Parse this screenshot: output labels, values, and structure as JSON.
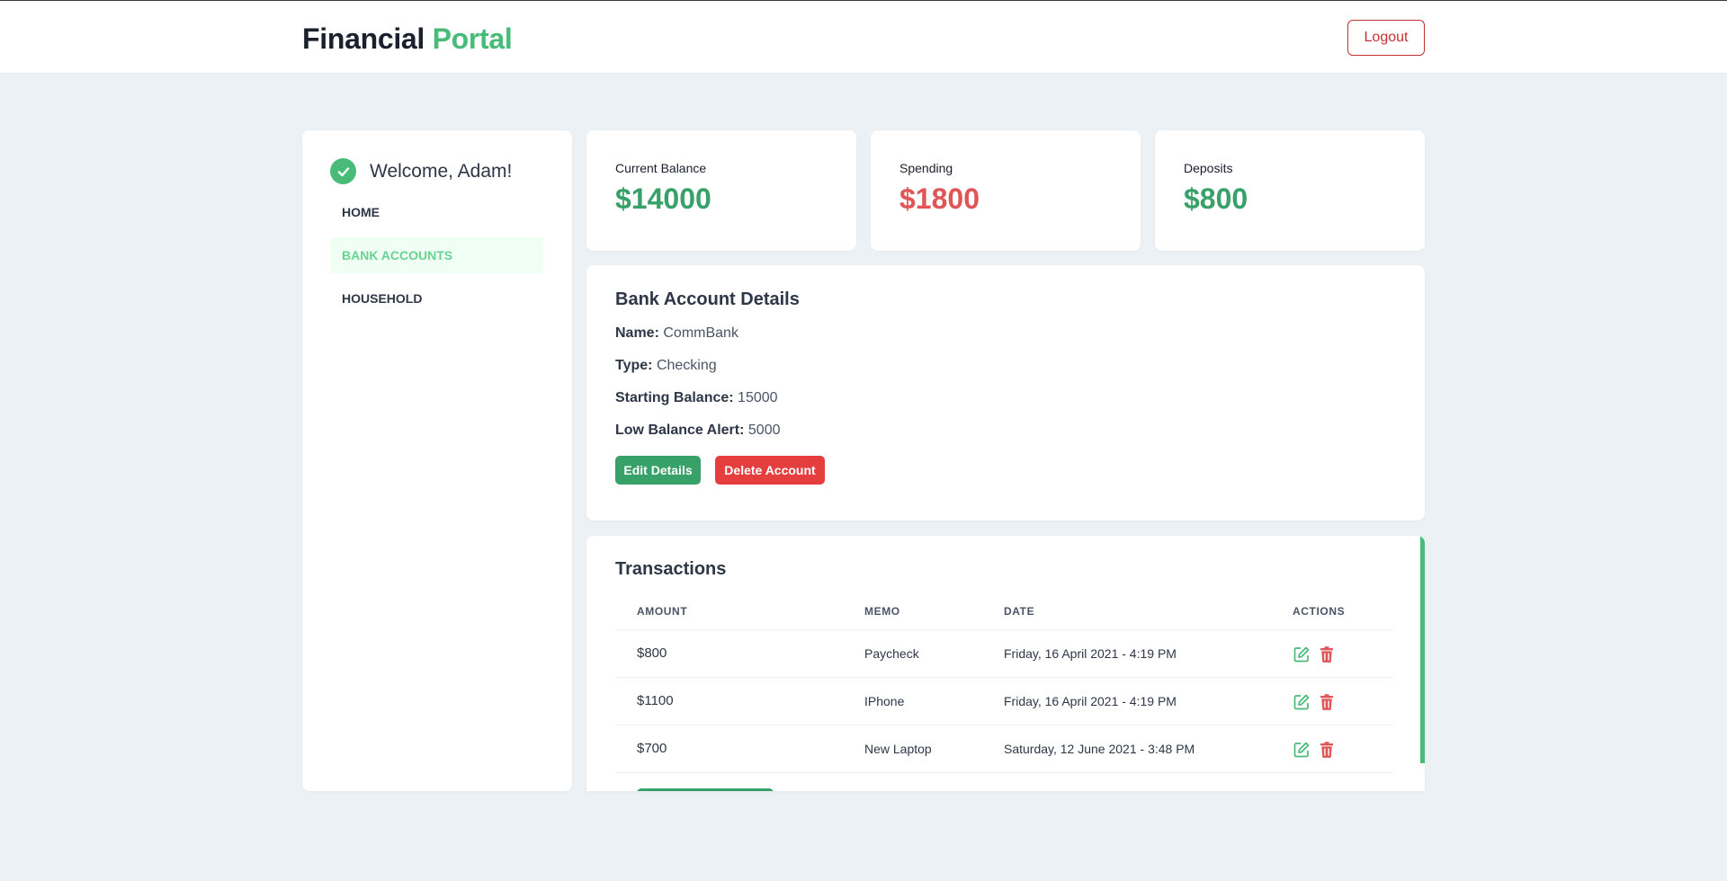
{
  "header": {
    "brand_part1": "Financial",
    "brand_part2": "Portal",
    "logout_label": "Logout"
  },
  "sidebar": {
    "welcome": "Welcome, Adam!",
    "items": [
      {
        "label": "HOME",
        "active": false
      },
      {
        "label": "BANK ACCOUNTS",
        "active": true
      },
      {
        "label": "HOUSEHOLD",
        "active": false
      }
    ]
  },
  "stats": [
    {
      "label": "Current Balance",
      "value": "$14000",
      "tone": "positive"
    },
    {
      "label": "Spending",
      "value": "$1800",
      "tone": "negative"
    },
    {
      "label": "Deposits",
      "value": "$800",
      "tone": "positive"
    }
  ],
  "details": {
    "title": "Bank Account Details",
    "fields": [
      {
        "label": "Name:",
        "value": "CommBank"
      },
      {
        "label": "Type:",
        "value": "Checking"
      },
      {
        "label": "Starting Balance:",
        "value": "15000"
      },
      {
        "label": "Low Balance Alert:",
        "value": "5000"
      }
    ],
    "edit_label": "Edit Details",
    "delete_label": "Delete Account"
  },
  "transactions": {
    "title": "Transactions",
    "columns": [
      "AMOUNT",
      "MEMO",
      "DATE",
      "ACTIONS"
    ],
    "rows": [
      {
        "amount": "$800",
        "memo": "Paycheck",
        "date": "Friday, 16 April 2021 - 4:19 PM",
        "type": "deposit"
      },
      {
        "amount": "$1100",
        "memo": "IPhone",
        "date": "Friday, 16 April 2021 - 4:19 PM",
        "type": "withdrawal"
      },
      {
        "amount": "$700",
        "memo": "New Laptop",
        "date": "Saturday, 12 June 2021 - 3:48 PM",
        "type": "withdrawal"
      }
    ]
  },
  "colors": {
    "accent": "#48bb78",
    "positive": "#38a169",
    "negative": "#e05555",
    "background": "#ecf1f5"
  }
}
